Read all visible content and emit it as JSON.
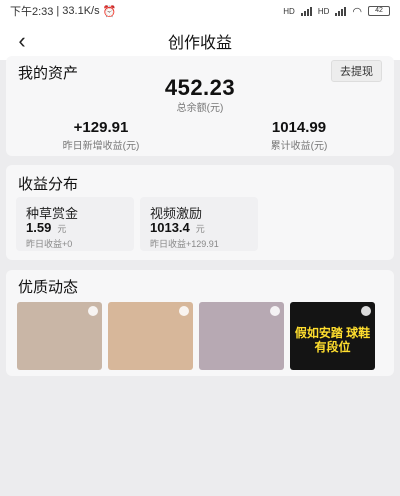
{
  "status": {
    "time": "下午2:33",
    "speed": "33.1K/s",
    "network": "HD",
    "battery": "42"
  },
  "nav": {
    "title": "创作收益"
  },
  "assets": {
    "title": "我的资产",
    "withdraw_label": "去提现",
    "balance": "452.23",
    "balance_label": "总余额(元)",
    "yesterday_value": "+129.91",
    "yesterday_label": "昨日新增收益(元)",
    "total_value": "1014.99",
    "total_label": "累计收益(元)"
  },
  "distribution": {
    "title": "收益分布",
    "items": [
      {
        "name": "种草赏金",
        "value": "1.59",
        "unit": "元",
        "sub": "昨日收益+0"
      },
      {
        "name": "视频激励",
        "value": "1013.4",
        "unit": "元",
        "sub": "昨日收益+129.91"
      }
    ]
  },
  "feed": {
    "title": "优质动态",
    "thumbs": [
      {
        "caption": "",
        "color": "#c9b6a6"
      },
      {
        "caption": "",
        "color": "#d7b79a"
      },
      {
        "caption": "",
        "color": "#b7a9b3"
      },
      {
        "caption": "假如安踏 球鞋有段位",
        "color": "#141414"
      }
    ]
  }
}
